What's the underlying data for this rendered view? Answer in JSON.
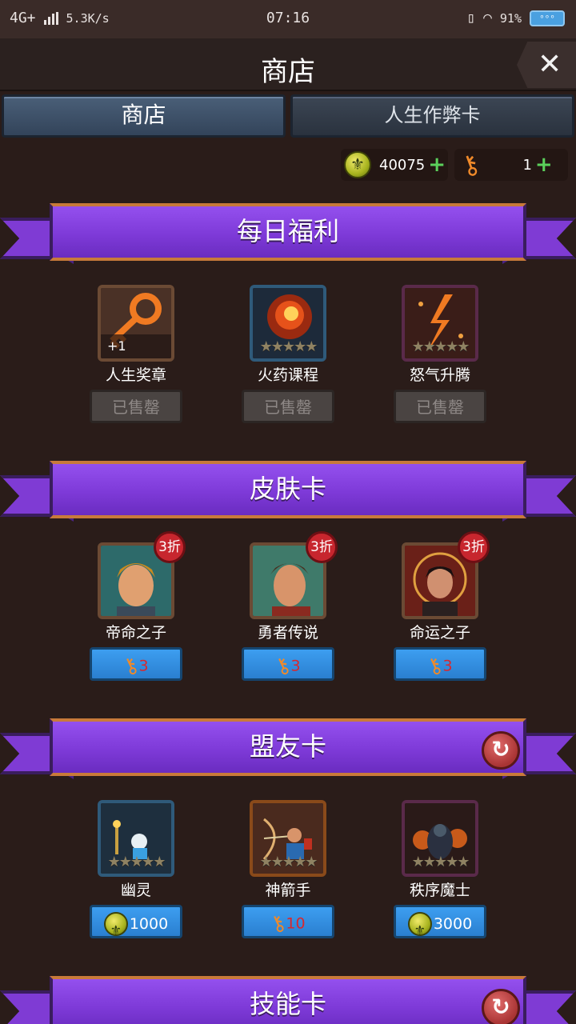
{
  "status_bar": {
    "network": "4G+",
    "speed": "5.3K/s",
    "time": "07:16",
    "battery": "91%",
    "battery_label": "ᵒᵒᵒ"
  },
  "header": {
    "title": "商店",
    "close": "✕"
  },
  "tabs": [
    {
      "label": "商店",
      "active": true
    },
    {
      "label": "人生作弊卡",
      "active": false
    }
  ],
  "currency": {
    "coins": "40075",
    "keys": "1",
    "plus": "+"
  },
  "sections": [
    {
      "title": "每日福利",
      "items": [
        {
          "name": "人生奖章",
          "qty": "+1",
          "button": "已售罄",
          "status": "sold"
        },
        {
          "name": "火药课程",
          "button": "已售罄",
          "status": "sold"
        },
        {
          "name": "怒气升腾",
          "button": "已售罄",
          "status": "sold"
        }
      ]
    },
    {
      "title": "皮肤卡",
      "items": [
        {
          "name": "帝命之子",
          "badge": "3折",
          "price": "3",
          "currency": "key"
        },
        {
          "name": "勇者传说",
          "badge": "3折",
          "price": "3",
          "currency": "key"
        },
        {
          "name": "命运之子",
          "badge": "3折",
          "price": "3",
          "currency": "key"
        }
      ]
    },
    {
      "title": "盟友卡",
      "refresh": "↻",
      "items": [
        {
          "name": "幽灵",
          "price": "1000",
          "currency": "coin"
        },
        {
          "name": "神箭手",
          "price": "10",
          "currency": "key"
        },
        {
          "name": "秩序魔士",
          "price": "3000",
          "currency": "coin"
        }
      ]
    },
    {
      "title": "技能卡",
      "refresh": "↻"
    }
  ],
  "stars": "★★★★★",
  "colors": {
    "background": "#2a1c19",
    "banner": "#8444e0",
    "buy_button": "#3390e0",
    "sold_button": "#4a4442",
    "badge": "#c7262e"
  }
}
